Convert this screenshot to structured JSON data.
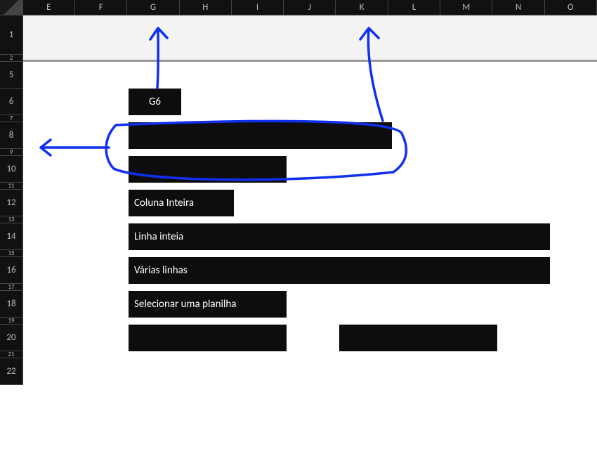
{
  "columns": [
    {
      "letter": "E",
      "w": 75
    },
    {
      "letter": "F",
      "w": 75
    },
    {
      "letter": "G",
      "w": 75
    },
    {
      "letter": "H",
      "w": 75
    },
    {
      "letter": "I",
      "w": 75
    },
    {
      "letter": "J",
      "w": 75
    },
    {
      "letter": "K",
      "w": 75
    },
    {
      "letter": "L",
      "w": 75
    },
    {
      "letter": "M",
      "w": 75
    },
    {
      "letter": "N",
      "w": 75
    },
    {
      "letter": "O",
      "w": 75
    }
  ],
  "rows": [
    {
      "num": "1",
      "h": 56
    },
    {
      "num": "2",
      "h": 10
    },
    {
      "num": "5",
      "h": 38
    },
    {
      "num": "6",
      "h": 38
    },
    {
      "num": "7",
      "h": 10
    },
    {
      "num": "8",
      "h": 38
    },
    {
      "num": "9",
      "h": 10
    },
    {
      "num": "10",
      "h": 38
    },
    {
      "num": "11",
      "h": 10
    },
    {
      "num": "12",
      "h": 38
    },
    {
      "num": "13",
      "h": 10
    },
    {
      "num": "14",
      "h": 38
    },
    {
      "num": "15",
      "h": 10
    },
    {
      "num": "16",
      "h": 38
    },
    {
      "num": "17",
      "h": 10
    },
    {
      "num": "18",
      "h": 38
    },
    {
      "num": "19",
      "h": 10
    },
    {
      "num": "20",
      "h": 38
    },
    {
      "num": "21",
      "h": 10
    },
    {
      "num": "22",
      "h": 38
    }
  ],
  "cells": {
    "g6": "G6",
    "g12": "Coluna Inteira",
    "g14": "Linha inteia",
    "g16": "Várias linhas",
    "g18": "Selecionar uma planilha"
  },
  "annotation_color": "#1030f0"
}
